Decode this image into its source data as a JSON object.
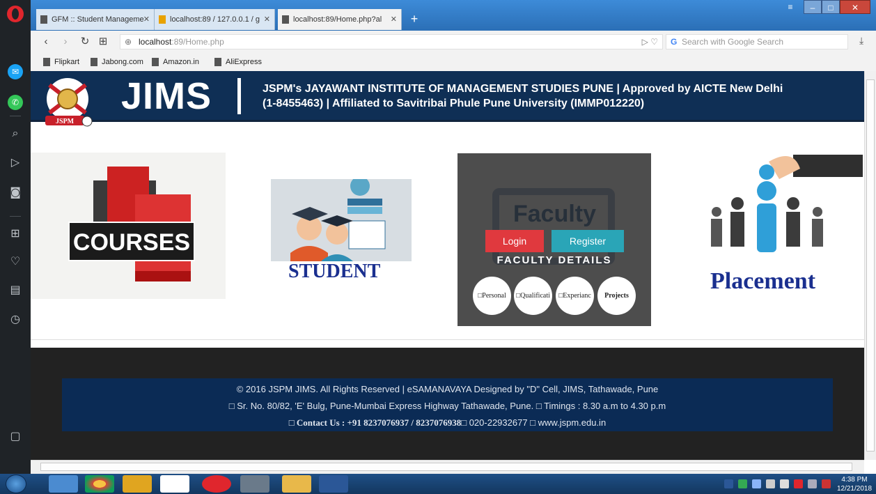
{
  "browser": {
    "tabs": [
      {
        "label": "GFM :: Student Manageme",
        "close": "✕"
      },
      {
        "label": "localhost:89 / 127.0.0.1 / g",
        "close": "✕"
      },
      {
        "label": "localhost:89/Home.php?al",
        "close": "✕"
      }
    ],
    "new_tab": "+",
    "url_host": "localhost",
    "url_path": ":89/Home.php",
    "search_placeholder": "Search with Google Search",
    "bookmarks": [
      "Flipkart",
      "Jabong.com",
      "Amazon.in",
      "AliExpress"
    ]
  },
  "site": {
    "brand": "JIMS",
    "logo_text": "JSPM",
    "institute_line1": "JSPM's JAYAWANT INSTITUTE OF MANAGEMENT STUDIES PUNE | Approved by AICTE New Delhi",
    "institute_line2": "(1-8455463) | Affiliated to Savitribai Phule Pune University (IMMP012220)"
  },
  "cards": {
    "courses": "COURSES",
    "student": "STUDENT",
    "faculty_word": "Faculty",
    "login": "Login",
    "register": "Register",
    "faculty_details": "FACULTY DETAILS",
    "circles": [
      "□Personal",
      "□Qualificati",
      "□Experianc",
      "Projects"
    ],
    "placement": "Placement"
  },
  "footer": {
    "line1": "© 2016 JSPM JIMS. All Rights Reserved | eSAMANAVAYA Designed by \"D\" Cell, JIMS, Tathawade, Pune",
    "line2": "□ Sr. No. 80/82, 'E' Bulg, Pune-Mumbai Express Highway Tathawade, Pune. □ Timings : 8.30 a.m to 4.30 p.m",
    "line3_contact": "□ Contact Us : +91 8237076937 / 8237076938□",
    "line3_rest": " 020-22932677 □ www.jspm.edu.in"
  },
  "taskbar": {
    "time": "4:38 PM",
    "date": "12/21/2018"
  }
}
